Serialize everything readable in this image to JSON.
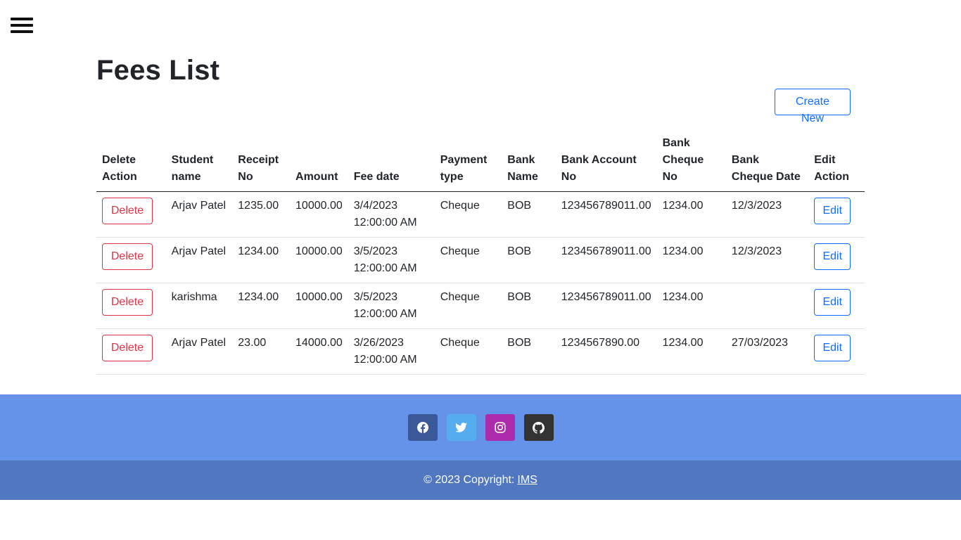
{
  "page": {
    "title": "Fees List"
  },
  "toolbar": {
    "create_label": "Create New"
  },
  "table": {
    "headers": {
      "delete_action": "Delete Action",
      "student_name": "Student name",
      "receipt_no": "Receipt No",
      "amount": "Amount",
      "fee_date": "Fee date",
      "payment_type": "Payment type",
      "bank_name": "Bank Name",
      "bank_account_no": "Bank Account No",
      "bank_cheque_no": "Bank Cheque No",
      "bank_cheque_date": "Bank Cheque Date",
      "edit_action": "Edit Action"
    },
    "delete_label": "Delete",
    "edit_label": "Edit",
    "rows": [
      {
        "student_name": "Arjav Patel",
        "receipt_no": "1235.00",
        "amount": "10000.00",
        "fee_date": "3/4/2023 12:00:00 AM",
        "payment_type": "Cheque",
        "bank_name": "BOB",
        "bank_account_no": "123456789011.00",
        "bank_cheque_no": "1234.00",
        "bank_cheque_date": "12/3/2023"
      },
      {
        "student_name": "Arjav Patel",
        "receipt_no": "1234.00",
        "amount": "10000.00",
        "fee_date": "3/5/2023 12:00:00 AM",
        "payment_type": "Cheque",
        "bank_name": "BOB",
        "bank_account_no": "123456789011.00",
        "bank_cheque_no": "1234.00",
        "bank_cheque_date": "12/3/2023"
      },
      {
        "student_name": "karishma",
        "receipt_no": "1234.00",
        "amount": "10000.00",
        "fee_date": "3/5/2023 12:00:00 AM",
        "payment_type": "Cheque",
        "bank_name": "BOB",
        "bank_account_no": "123456789011.00",
        "bank_cheque_no": "1234.00",
        "bank_cheque_date": ""
      },
      {
        "student_name": "Arjav Patel",
        "receipt_no": "23.00",
        "amount": "14000.00",
        "fee_date": "3/26/2023 12:00:00 AM",
        "payment_type": "Cheque",
        "bank_name": "BOB",
        "bank_account_no": "1234567890.00",
        "bank_cheque_no": "1234.00",
        "bank_cheque_date": "27/03/2023"
      }
    ]
  },
  "footer": {
    "social": [
      {
        "name": "facebook",
        "icon": "facebook-icon",
        "color": "#3b5998"
      },
      {
        "name": "twitter",
        "icon": "twitter-icon",
        "color": "#55acee"
      },
      {
        "name": "instagram",
        "icon": "instagram-icon",
        "color": "#ac2bac"
      },
      {
        "name": "github",
        "icon": "github-icon",
        "color": "#333333"
      }
    ],
    "copyright_text": "© 2023 Copyright:",
    "copyright_link": "IMS"
  },
  "colors": {
    "primary": "#0d6efd",
    "danger": "#dc3545",
    "footer_top": "#6593e9",
    "footer_bottom": "#5077c0"
  }
}
